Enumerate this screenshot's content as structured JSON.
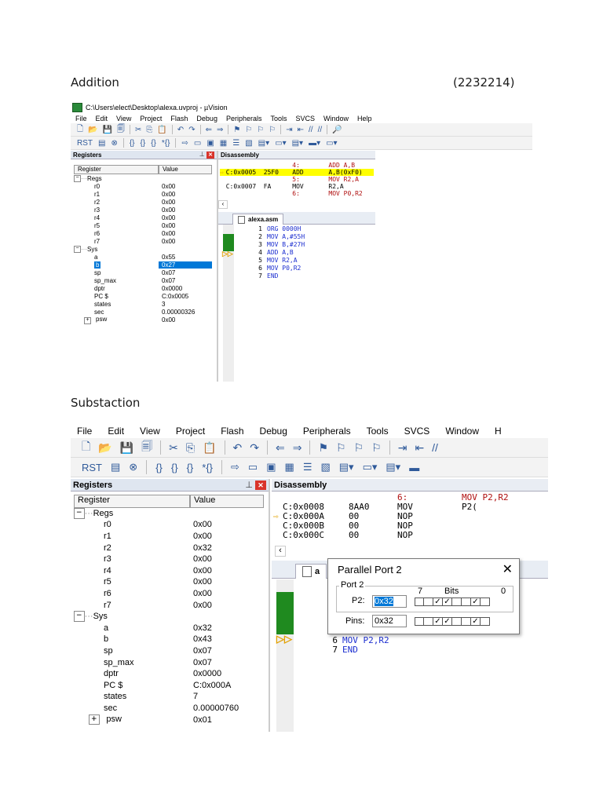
{
  "doc": {
    "heading1": "Addition",
    "student_id": "(2232214)",
    "heading2": "Substaction"
  },
  "win1": {
    "title": "C:\\Users\\elect\\Desktop\\alexa.uvproj - µVision",
    "menu": [
      "File",
      "Edit",
      "View",
      "Project",
      "Flash",
      "Debug",
      "Peripherals",
      "Tools",
      "SVCS",
      "Window",
      "Help"
    ],
    "registers_title": "Registers",
    "col_register": "Register",
    "col_value": "Value",
    "regs_group": "Regs",
    "sys_group": "Sys",
    "regs": [
      {
        "name": "r0",
        "value": "0x00"
      },
      {
        "name": "r1",
        "value": "0x00"
      },
      {
        "name": "r2",
        "value": "0x00"
      },
      {
        "name": "r3",
        "value": "0x00"
      },
      {
        "name": "r4",
        "value": "0x00"
      },
      {
        "name": "r5",
        "value": "0x00"
      },
      {
        "name": "r6",
        "value": "0x00"
      },
      {
        "name": "r7",
        "value": "0x00"
      }
    ],
    "sys": [
      {
        "name": "a",
        "value": "0x55"
      },
      {
        "name": "b",
        "value": "0x27"
      },
      {
        "name": "sp",
        "value": "0x07"
      },
      {
        "name": "sp_max",
        "value": "0x07"
      },
      {
        "name": "dptr",
        "value": "0x0000"
      },
      {
        "name": "PC $",
        "value": "C:0x0005"
      },
      {
        "name": "states",
        "value": "3"
      },
      {
        "name": "sec",
        "value": "0.00000326"
      },
      {
        "name": "psw",
        "value": "0x00"
      }
    ],
    "disassembly_title": "Disassembly",
    "disasm": [
      {
        "addr": "",
        "code": "",
        "mn": "4:",
        "ops": "ADD A,B",
        "type": "src"
      },
      {
        "addr": "C:0x0005",
        "code": "25F0",
        "mn": "ADD",
        "ops": "A,B(0xF0)",
        "type": "hl"
      },
      {
        "addr": "",
        "code": "",
        "mn": "5:",
        "ops": "MOV R2,A",
        "type": "src"
      },
      {
        "addr": "C:0x0007",
        "code": "FA",
        "mn": "MOV",
        "ops": "R2,A",
        "type": "asm"
      },
      {
        "addr": "",
        "code": "",
        "mn": "6:",
        "ops": "MOV P0,R2",
        "type": "src"
      }
    ],
    "editor_tab": "alexa.asm",
    "code": [
      {
        "n": "1",
        "t": "ORG 0000H"
      },
      {
        "n": "2",
        "t": "MOV A,#55H"
      },
      {
        "n": "3",
        "t": "MOV B,#27H"
      },
      {
        "n": "4",
        "t": "ADD A,B"
      },
      {
        "n": "5",
        "t": "MOV R2,A"
      },
      {
        "n": "6",
        "t": "MOV P0,R2"
      },
      {
        "n": "7",
        "t": "END"
      }
    ]
  },
  "win2": {
    "menu": [
      "File",
      "Edit",
      "View",
      "Project",
      "Flash",
      "Debug",
      "Peripherals",
      "Tools",
      "SVCS",
      "Window",
      "H"
    ],
    "registers_title": "Registers",
    "col_register": "Register",
    "col_value": "Value",
    "regs_group": "Regs",
    "sys_group": "Sys",
    "regs": [
      {
        "name": "r0",
        "value": "0x00"
      },
      {
        "name": "r1",
        "value": "0x00"
      },
      {
        "name": "r2",
        "value": "0x32"
      },
      {
        "name": "r3",
        "value": "0x00"
      },
      {
        "name": "r4",
        "value": "0x00"
      },
      {
        "name": "r5",
        "value": "0x00"
      },
      {
        "name": "r6",
        "value": "0x00"
      },
      {
        "name": "r7",
        "value": "0x00"
      }
    ],
    "sys": [
      {
        "name": "a",
        "value": "0x32"
      },
      {
        "name": "b",
        "value": "0x43"
      },
      {
        "name": "sp",
        "value": "0x07"
      },
      {
        "name": "sp_max",
        "value": "0x07"
      },
      {
        "name": "dptr",
        "value": "0x0000"
      },
      {
        "name": "PC $",
        "value": "C:0x000A"
      },
      {
        "name": "states",
        "value": "7"
      },
      {
        "name": "sec",
        "value": "0.00000760"
      },
      {
        "name": "psw",
        "value": "0x01"
      }
    ],
    "disassembly_title": "Disassembly",
    "disasm": [
      {
        "addr": "",
        "code": "",
        "mn": "6:",
        "ops": "MOV P2,R2",
        "type": "src"
      },
      {
        "addr": "C:0x0008",
        "code": "8AA0",
        "mn": "MOV",
        "ops": "P2(",
        "type": "asm"
      },
      {
        "addr": "C:0x000A",
        "code": "00",
        "mn": "NOP",
        "ops": "",
        "type": "cur"
      },
      {
        "addr": "C:0x000B",
        "code": "00",
        "mn": "NOP",
        "ops": "",
        "type": "asm"
      },
      {
        "addr": "C:0x000C",
        "code": "00",
        "mn": "NOP",
        "ops": "",
        "type": "asm"
      }
    ],
    "editor_tab": "a",
    "code": [
      {
        "n": "6",
        "t": "MOV P2,R2"
      },
      {
        "n": "7",
        "t": "END"
      }
    ],
    "dialog": {
      "title": "Parallel Port 2",
      "group": "Port 2",
      "bit_hi": "7",
      "bits_label": "Bits",
      "bit_lo": "0",
      "p2_label": "P2:",
      "p2_value": "0x32",
      "pins_label": "Pins:",
      "pins_value": "0x32",
      "p2_bits": [
        0,
        0,
        1,
        1,
        0,
        0,
        1,
        0
      ],
      "pins_bits": [
        0,
        0,
        1,
        1,
        0,
        0,
        1,
        0
      ]
    }
  }
}
